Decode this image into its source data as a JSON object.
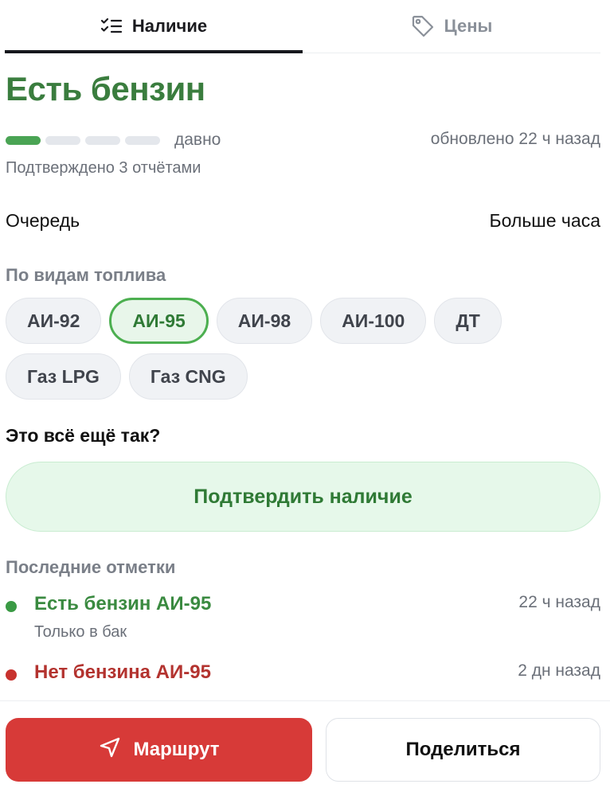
{
  "tabs": [
    {
      "label": "Наличие",
      "icon": "checklist-icon",
      "active": true
    },
    {
      "label": "Цены",
      "icon": "price-tag-icon",
      "active": false
    }
  ],
  "status": {
    "title": "Есть бензин",
    "color": "#3a7d3e",
    "freshness_label": "давно",
    "freshness_level": 0.25,
    "updated": "обновлено 22 ч назад",
    "confirmed": "Подтверждено 3 отчётами"
  },
  "queue": {
    "label": "Очередь",
    "value": "Больше часа"
  },
  "fuel_types": {
    "heading": "По видам топлива",
    "selected": "АИ-95",
    "items": [
      "АИ-92",
      "АИ-95",
      "АИ-98",
      "АИ-100",
      "ДТ",
      "Газ LPG",
      "Газ CNG"
    ]
  },
  "confirm": {
    "question": "Это всё ещё так?",
    "button_label": "Подтвердить наличие"
  },
  "recent": {
    "heading": "Последние отметки",
    "items": [
      {
        "title": "Есть бензин АИ-95",
        "note": "Только в бак",
        "time": "22 ч назад",
        "color": "#3a8a40"
      },
      {
        "title": "Нет бензина АИ-95",
        "note": "",
        "time": "2 дн назад",
        "color": "#b3332f"
      }
    ]
  },
  "actions": {
    "route_label": "Маршрут",
    "route_icon": "navigation-arrow-icon",
    "route_color": "#d73a38",
    "share_label": "Поделиться"
  }
}
